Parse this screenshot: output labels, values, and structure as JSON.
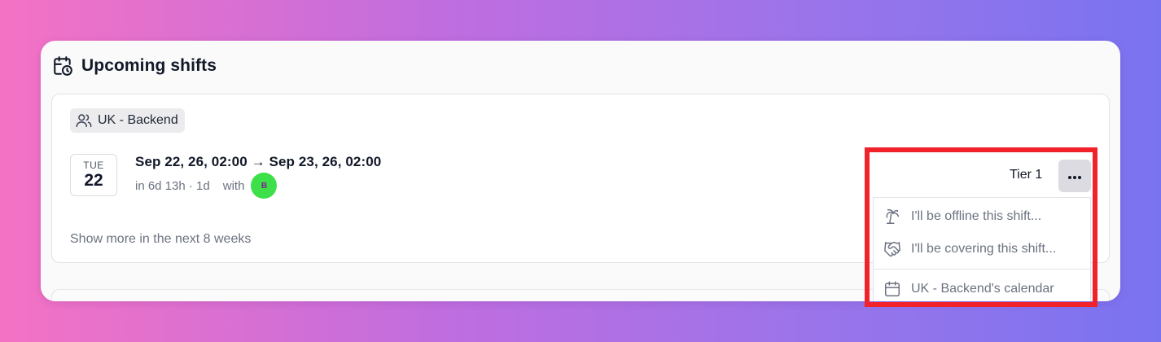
{
  "card": {
    "title": "Upcoming shifts",
    "title_icon": "calendar-clock-icon"
  },
  "team": {
    "name": "UK - Backend",
    "icon": "users-icon"
  },
  "shift": {
    "day_of_week": "TUE",
    "day": "22",
    "range": "Sep 22, 26, 02:00 → Sep 23, 26, 02:00",
    "relative": "in 6d 13h · 1d",
    "with_label": "with",
    "partner_initial": "B",
    "tier": "Tier 1"
  },
  "show_more": "Show more in the next 8 weeks",
  "menu": {
    "items": [
      {
        "label": "I'll be offline this shift...",
        "icon": "palm-tree-icon"
      },
      {
        "label": "I'll be covering this shift...",
        "icon": "handshake-icon"
      },
      {
        "label": "UK - Backend's calendar",
        "icon": "calendar-icon"
      }
    ]
  },
  "colors": {
    "accent_highlight": "#f2222a",
    "avatar_bg": "#3ee04a",
    "card_bg": "#fafafa",
    "muted_text": "#6b7280"
  }
}
